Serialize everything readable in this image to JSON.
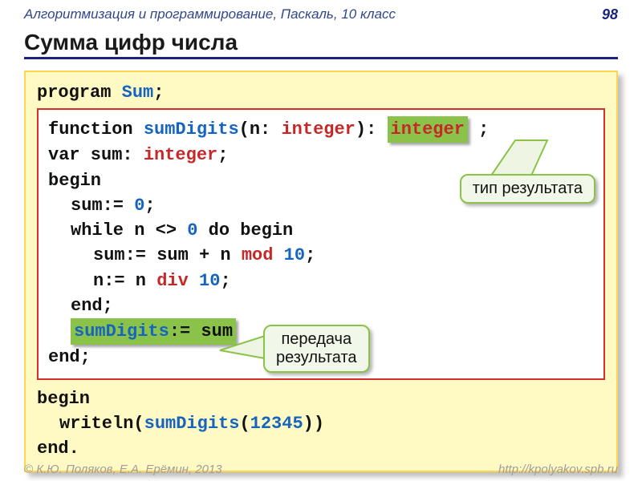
{
  "header": {
    "course": "Алгоритмизация и программирование, Паскаль, 10 класс",
    "page": "98"
  },
  "title": "Сумма цифр числа",
  "code": {
    "l_prog_kw": "program",
    "l_prog_name": "Sum",
    "semi": ";",
    "fn_kw": "function",
    "fn_name": "sumDigits",
    "fn_open": "(n: ",
    "fn_param_type": "integer",
    "fn_close_colon": "):",
    "fn_ret_type": "integer",
    "var_line_pre": "var sum: ",
    "var_type": "integer",
    "begin": "begin",
    "assign_zero_pre": "sum:= ",
    "zero": "0",
    "while_pre": "while n <> ",
    "while_zero": "0",
    "while_post": " do begin",
    "sum_line_pre": "sum:= sum + n ",
    "mod": "mod",
    "sum_line_num": " 10",
    "n_line_pre": "n:= n ",
    "div": "div",
    "n_line_num": " 10",
    "end": "end",
    "ret_label": "sumDigits",
    "ret_post": ":= sum",
    "writeln_pre": "writeln(",
    "call_name": "sumDigits",
    "call_open": "(",
    "call_arg": "12345",
    "call_close": "))",
    "end_dot": "end."
  },
  "callouts": {
    "return_type": "тип результата",
    "pass_l1": "передача",
    "pass_l2": "результата"
  },
  "footer": {
    "left": "© К.Ю. Поляков, Е.А. Ерёмин, 2013",
    "right": "http://kpolyakov.spb.ru"
  }
}
